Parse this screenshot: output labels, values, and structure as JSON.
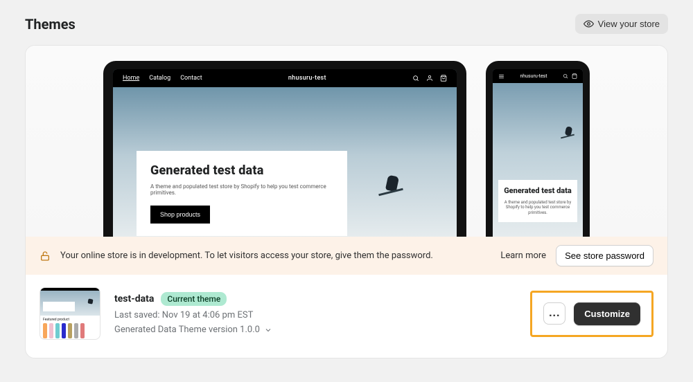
{
  "header": {
    "title": "Themes",
    "view_store_label": "View your store"
  },
  "preview": {
    "desktop": {
      "nav": {
        "items": [
          "Home",
          "Catalog",
          "Contact"
        ],
        "brand": "nhusuru-test"
      },
      "hero": {
        "title": "Generated test data",
        "subtitle": "A theme and populated test store by Shopify to help you test commerce primitives.",
        "button": "Shop products"
      }
    },
    "mobile": {
      "nav": {
        "brand": "nhusuru-test"
      },
      "hero": {
        "title": "Generated test data",
        "subtitle": "A theme and populated test store by Shopify to help you test commerce primitives."
      }
    }
  },
  "dev_banner": {
    "message": "Your online store is in development. To let visitors access your store, give them the password.",
    "learn_more": "Learn more",
    "see_password": "See store password"
  },
  "theme": {
    "name": "test-data",
    "badge": "Current theme",
    "last_saved": "Last saved: Nov 19 at 4:06 pm EST",
    "version": "Generated Data Theme version 1.0.0",
    "thumb_featured": "Featured product",
    "more_label": "...",
    "customize_label": "Customize"
  }
}
